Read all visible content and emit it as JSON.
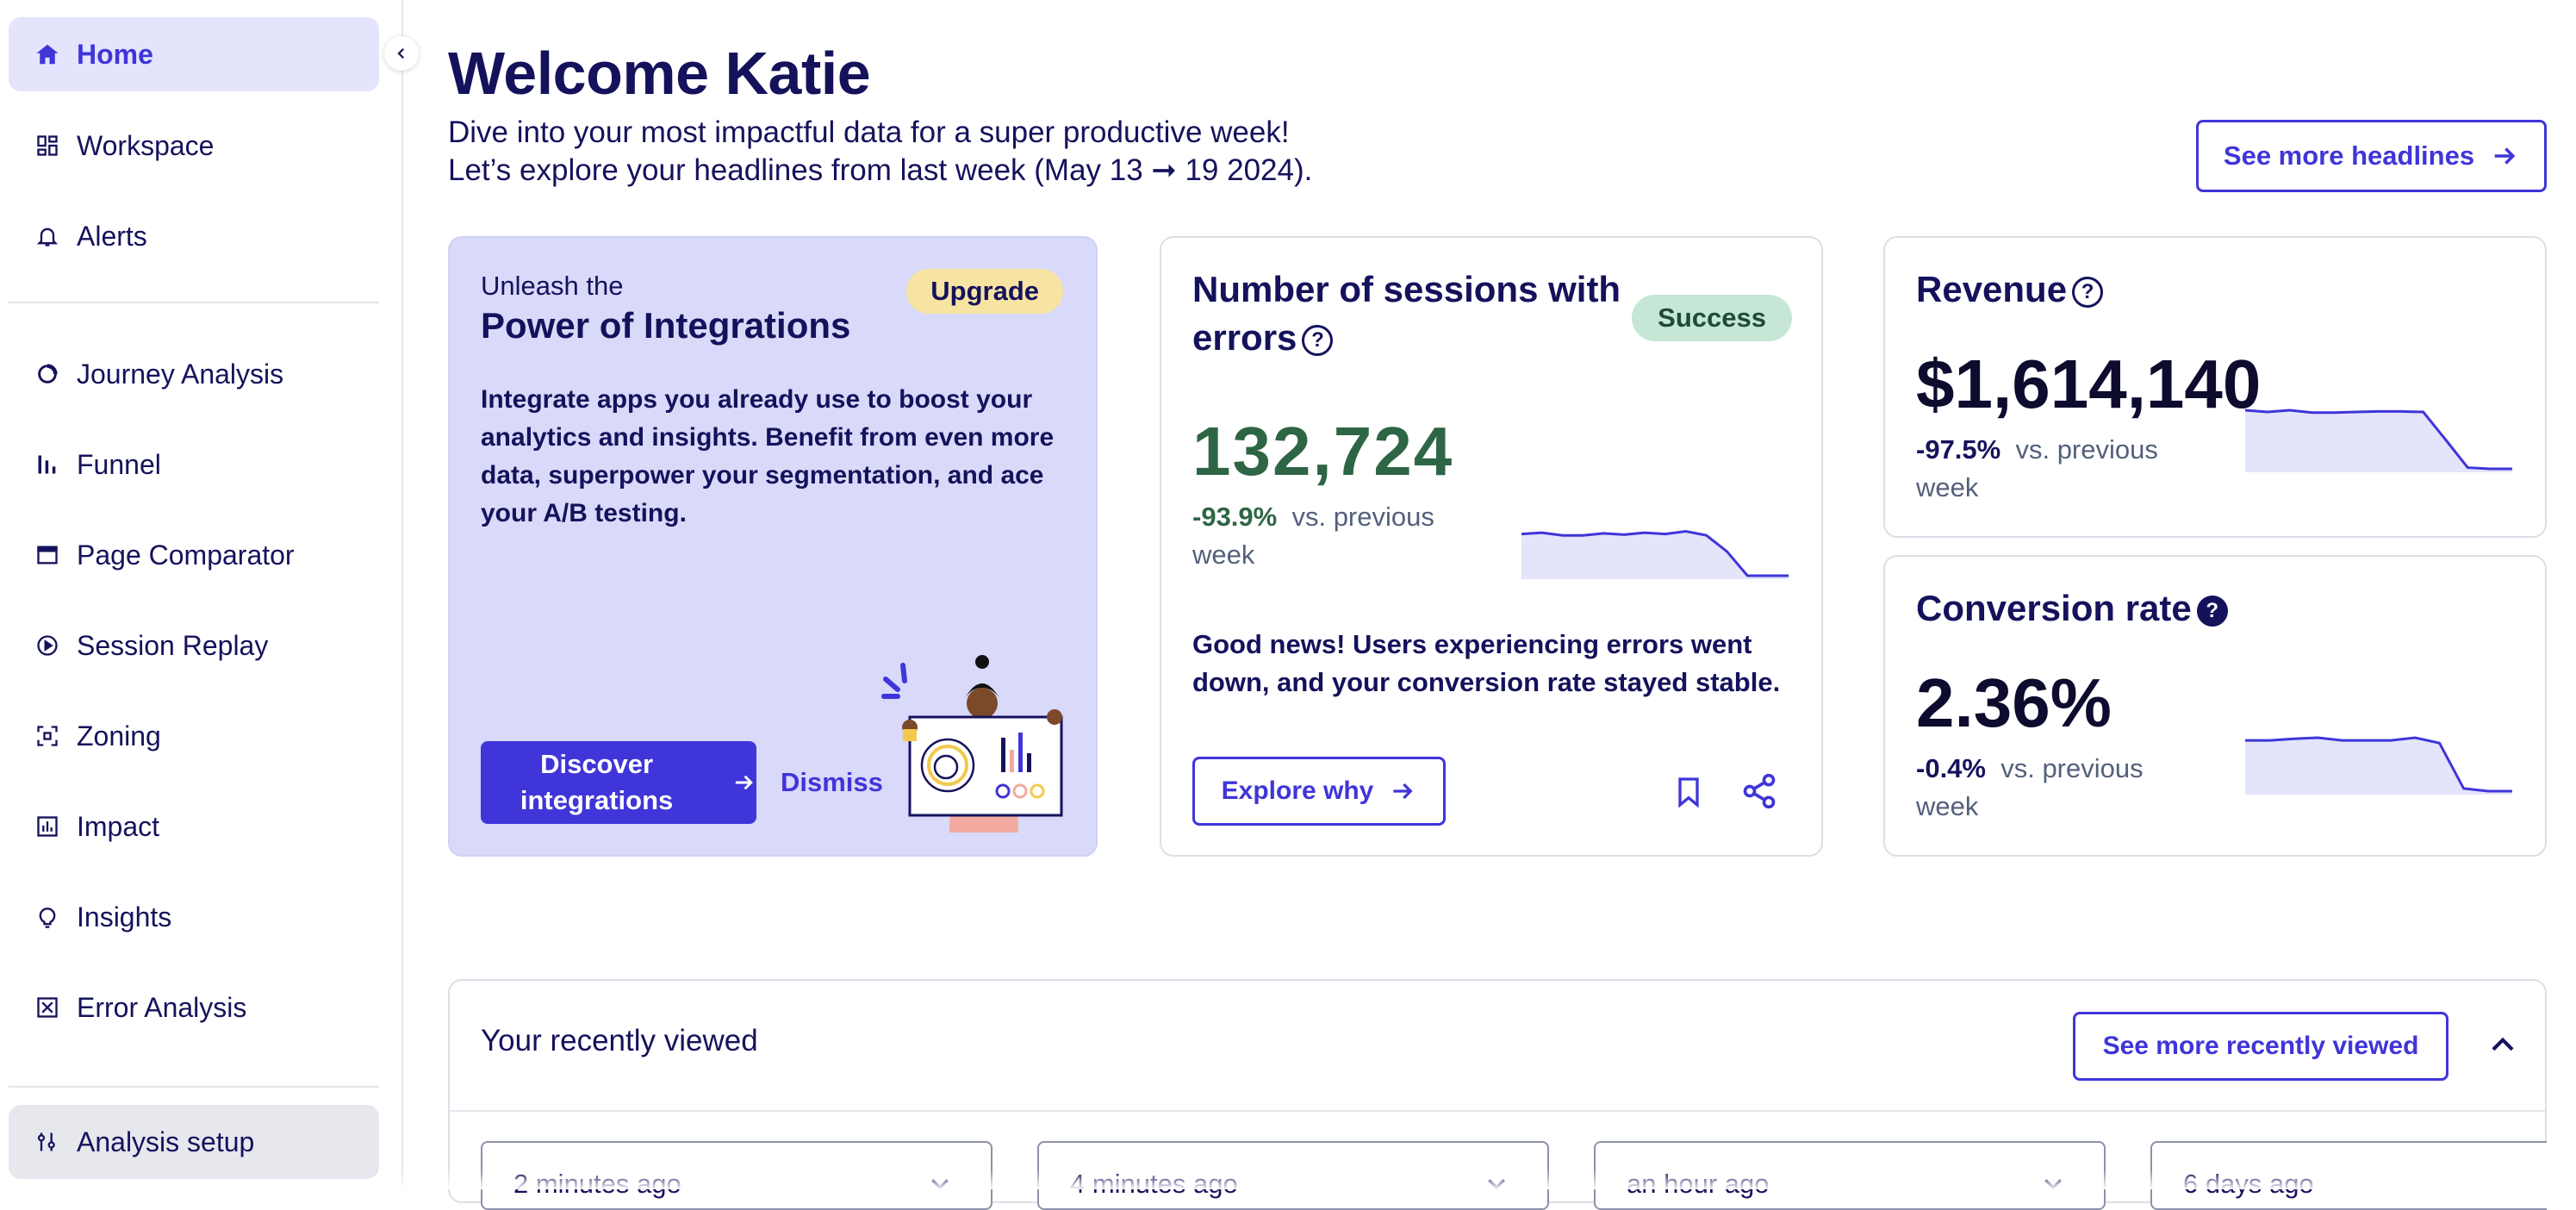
{
  "sidebar": {
    "items": [
      {
        "label": "Home",
        "icon": "home-icon",
        "active": true
      },
      {
        "label": "Workspace",
        "icon": "workspace-grid-icon"
      },
      {
        "label": "Alerts",
        "icon": "bell-icon"
      },
      {
        "label": "Journey Analysis",
        "icon": "journey-icon"
      },
      {
        "label": "Funnel",
        "icon": "funnel-bars-icon"
      },
      {
        "label": "Page Comparator",
        "icon": "window-icon"
      },
      {
        "label": "Session Replay",
        "icon": "play-circle-icon"
      },
      {
        "label": "Zoning",
        "icon": "zoning-icon"
      },
      {
        "label": "Impact",
        "icon": "bar-chart-icon"
      },
      {
        "label": "Insights",
        "icon": "lightbulb-icon"
      },
      {
        "label": "Error Analysis",
        "icon": "error-icon"
      }
    ],
    "setup": {
      "label": "Analysis setup",
      "icon": "sliders-icon"
    }
  },
  "header": {
    "title": "Welcome Katie",
    "subtitle_line1": "Dive into your most impactful data for a super productive week!",
    "subtitle_line2": "Let’s explore your headlines from last week (May 13 ➞ 19 2024).",
    "see_more_headlines": "See more headlines"
  },
  "promo": {
    "kicker": "Unleash the",
    "title": "Power of Integrations",
    "badge": "Upgrade",
    "body": "Integrate apps you already use to boost your analytics and insights. Benefit from even more data, superpower your segmentation, and ace your A/B testing.",
    "primary_button": "Discover integrations",
    "dismiss": "Dismiss"
  },
  "sessions_card": {
    "title": "Number of sessions with errors",
    "badge": "Success",
    "value": "132,724",
    "delta": "-93.9%",
    "delta_suffix": "vs. previous week",
    "insight": "Good news! Users experiencing errors went down, and your conversion rate stayed stable.",
    "explore_button": "Explore why",
    "sparkline": [
      0.62,
      0.64,
      0.6,
      0.6,
      0.63,
      0.61,
      0.64,
      0.62,
      0.66,
      0.6,
      0.36,
      0.0,
      0.0,
      0.0
    ],
    "accent_color": "#2e6645"
  },
  "revenue_card": {
    "title": "Revenue",
    "value": "$1,614,140",
    "delta": "-97.5%",
    "delta_suffix": "vs. previous week",
    "sparkline": [
      1.0,
      0.97,
      1.0,
      0.96,
      0.96,
      0.97,
      0.98,
      0.98,
      0.97,
      0.5,
      0.02,
      0.0,
      0.0
    ]
  },
  "conversion_card": {
    "title": "Conversion rate",
    "value": "2.36%",
    "delta": "-0.4%",
    "delta_suffix": "vs. previous week",
    "sparkline": [
      0.95,
      0.95,
      0.98,
      1.0,
      0.95,
      0.95,
      0.95,
      1.0,
      0.9,
      0.05,
      0.0,
      0.0
    ]
  },
  "recent": {
    "title": "Your recently viewed",
    "see_more": "See more recently viewed",
    "items": [
      "2 minutes ago",
      "4 minutes ago",
      "an hour ago",
      "6 days ago"
    ]
  },
  "colors": {
    "brand": "#3f35d9",
    "navy": "#15125c",
    "promo_bg": "#d9d9f9",
    "active_nav_bg": "#e4e4fc",
    "success_bg": "#c6e6d6",
    "upgrade_bg": "#f8e4a2",
    "sparkline_fill": "#e4e4fb"
  }
}
